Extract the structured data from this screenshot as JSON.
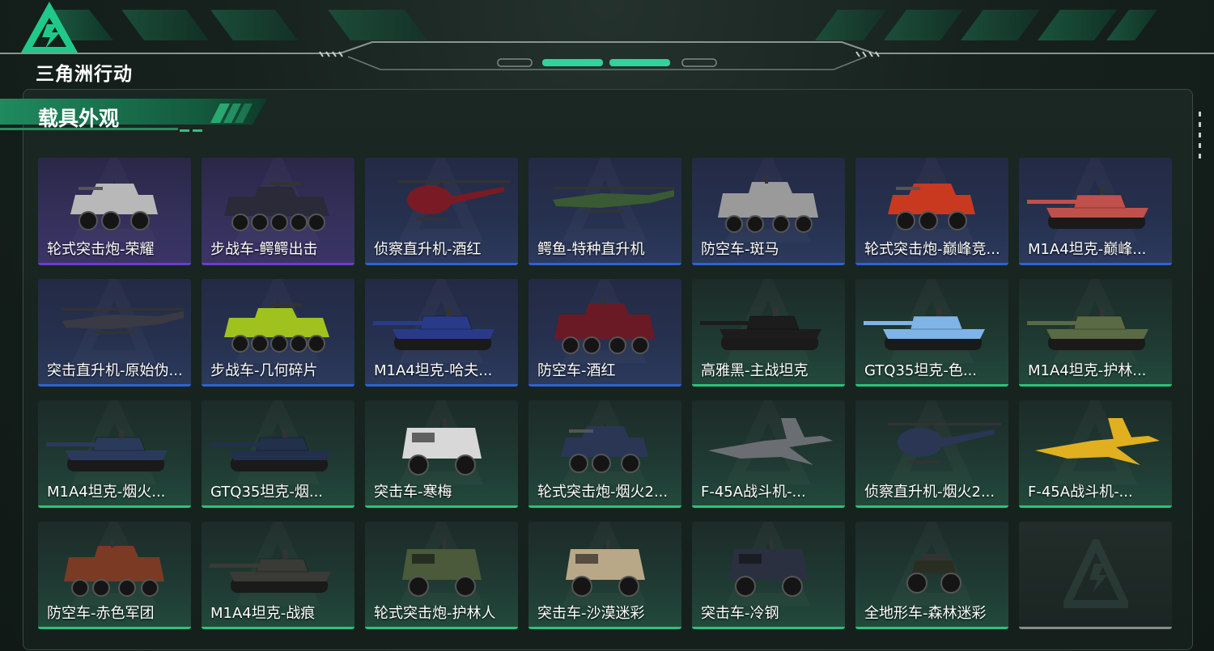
{
  "game": {
    "logo_text": "三角洲行动"
  },
  "section": {
    "title": "载具外观"
  },
  "colors": {
    "purple": "#6a3fc9",
    "blue": "#2c63d6",
    "green": "#27c47b",
    "empty": "#888c8a"
  },
  "items": [
    {
      "label": "轮式突击炮-荣耀",
      "rarity": "purple",
      "vehicle": "wheeled-assault-gun",
      "tint": "#b8b8b8"
    },
    {
      "label": "步战车-鳄鳄出击",
      "rarity": "purple",
      "vehicle": "ifv",
      "tint": "#2a2a38"
    },
    {
      "label": "侦察直升机-酒红",
      "rarity": "blue",
      "vehicle": "scout-helicopter",
      "tint": "#7a1a24"
    },
    {
      "label": "鳄鱼-特种直升机",
      "rarity": "blue",
      "vehicle": "attack-helicopter",
      "tint": "#3a5a34"
    },
    {
      "label": "防空车-斑马",
      "rarity": "blue",
      "vehicle": "aa-vehicle",
      "tint": "#9a9a9a"
    },
    {
      "label": "轮式突击炮-巅峰竞...",
      "rarity": "blue",
      "vehicle": "wheeled-assault-gun",
      "tint": "#c8391f"
    },
    {
      "label": "M1A4坦克-巅峰...",
      "rarity": "blue",
      "vehicle": "tank",
      "tint": "#c0504a"
    },
    {
      "label": "突击直升机-原始伪...",
      "rarity": "blue",
      "vehicle": "attack-helicopter",
      "tint": "#3a3a44"
    },
    {
      "label": "步战车-几何碎片",
      "rarity": "blue",
      "vehicle": "ifv",
      "tint": "#9fc21f"
    },
    {
      "label": "M1A4坦克-哈夫...",
      "rarity": "blue",
      "vehicle": "tank",
      "tint": "#2a3a8a"
    },
    {
      "label": "防空车-酒红",
      "rarity": "blue",
      "vehicle": "aa-vehicle",
      "tint": "#6a1a24"
    },
    {
      "label": "高雅黑-主战坦克",
      "rarity": "green",
      "vehicle": "tank",
      "tint": "#1c1c1c"
    },
    {
      "label": "GTQ35坦克-色...",
      "rarity": "green",
      "vehicle": "tank",
      "tint": "#7fb4e8"
    },
    {
      "label": "M1A4坦克-护林...",
      "rarity": "green",
      "vehicle": "tank",
      "tint": "#5a6a44"
    },
    {
      "label": "M1A4坦克-烟火...",
      "rarity": "green",
      "vehicle": "tank",
      "tint": "#2a3a5a"
    },
    {
      "label": "GTQ35坦克-烟...",
      "rarity": "green",
      "vehicle": "tank",
      "tint": "#22304c"
    },
    {
      "label": "突击车-寒梅",
      "rarity": "green",
      "vehicle": "armored-car",
      "tint": "#d8d8d8"
    },
    {
      "label": "轮式突击炮-烟火2...",
      "rarity": "green",
      "vehicle": "wheeled-assault-gun",
      "tint": "#2a3654"
    },
    {
      "label": "F-45A战斗机-...",
      "rarity": "green",
      "vehicle": "fighter-jet",
      "tint": "#6a6e72"
    },
    {
      "label": "侦察直升机-烟火2...",
      "rarity": "green",
      "vehicle": "scout-helicopter",
      "tint": "#2a3654"
    },
    {
      "label": "F-45A战斗机-...",
      "rarity": "green",
      "vehicle": "fighter-jet",
      "tint": "#e0b020"
    },
    {
      "label": "防空车-赤色军团",
      "rarity": "green",
      "vehicle": "aa-vehicle",
      "tint": "#7a3a24"
    },
    {
      "label": "M1A4坦克-战痕",
      "rarity": "green",
      "vehicle": "tank",
      "tint": "#3a3a36"
    },
    {
      "label": "轮式突击炮-护林人",
      "rarity": "green",
      "vehicle": "armored-car",
      "tint": "#4a5a3a"
    },
    {
      "label": "突击车-沙漠迷彩",
      "rarity": "green",
      "vehicle": "armored-car",
      "tint": "#b8a888"
    },
    {
      "label": "突击车-冷钢",
      "rarity": "green",
      "vehicle": "armored-car",
      "tint": "#2a3040"
    },
    {
      "label": "全地形车-森林迷彩",
      "rarity": "green",
      "vehicle": "atv",
      "tint": "#2a2e22"
    },
    {
      "label": "",
      "rarity": "empty",
      "vehicle": "none",
      "tint": "#444"
    }
  ]
}
